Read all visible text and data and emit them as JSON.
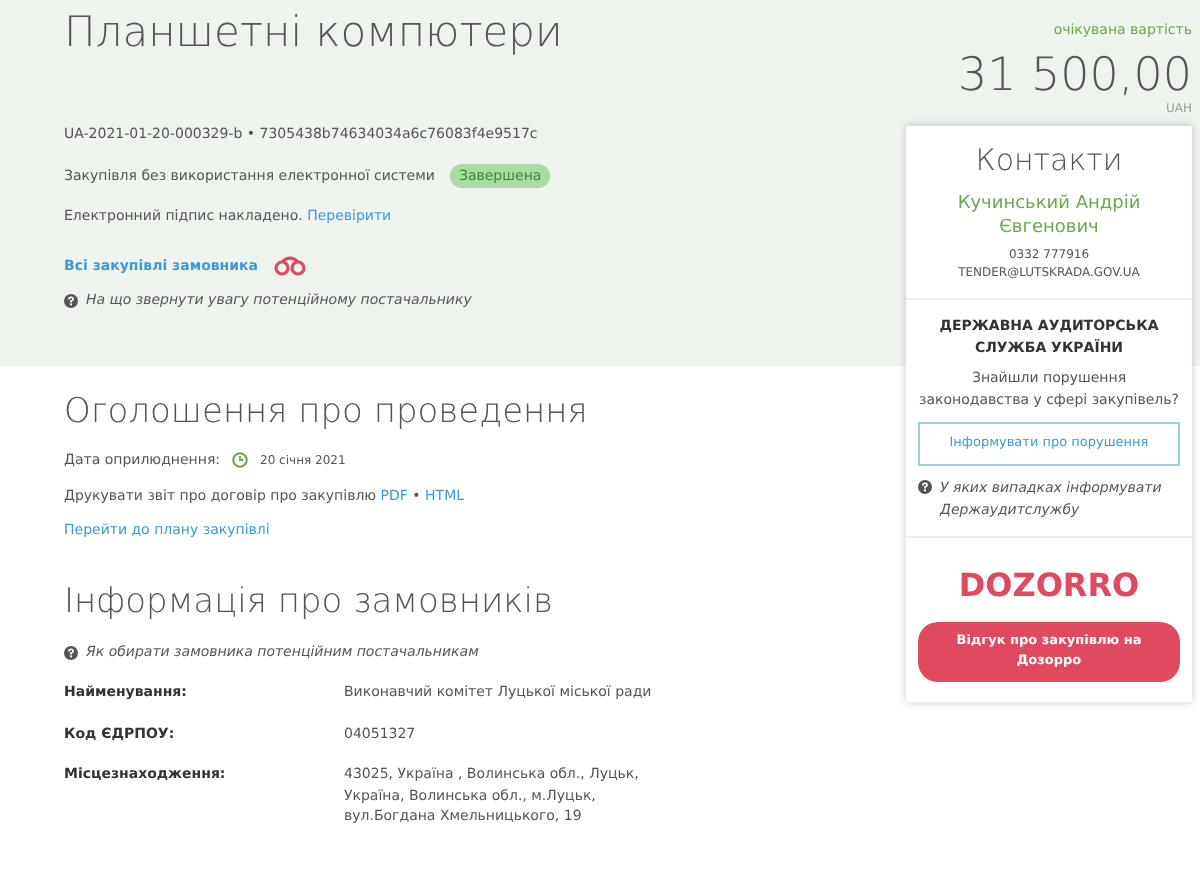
{
  "title": "Планшетні компютери",
  "price": {
    "label": "очікувана вартість",
    "amount": "31 500,00",
    "currency": "UAH"
  },
  "tender": {
    "id": "UA-2021-01-20-000329-b",
    "separator": "•",
    "hash": "7305438b74634034a6c76083f4e9517c",
    "procedure": "Закупівля без використання електронної системи",
    "status": "Завершена",
    "signature": "Електронний підпис накладено.",
    "signature_link": "Перевірити",
    "customer_link": "Всі закупівлі замовника",
    "hint": "На що звернути увагу потенційному постачальнику"
  },
  "announcement": {
    "heading": "Оголошення про проведення",
    "date_label": "Дата оприлюднення:",
    "date": "20 січня 2021",
    "print_label": "Друкувати звіт про договір про закупівлю",
    "print_links": [
      "PDF",
      "HTML"
    ],
    "separator": "•",
    "plan_link": "Перейти до плану закупівлі"
  },
  "customer": {
    "heading": "Інформація про замовників",
    "hint": "Як обирати замовника потенційним постачальникам",
    "rows": [
      {
        "label": "Найменування:",
        "value": "Виконавчий комітет Луцької міської ради"
      },
      {
        "label": "Код ЄДРПОУ:",
        "value": "04051327"
      },
      {
        "label": "Місцезнаходження:",
        "value": "43025, Україна , Волинська обл., Луцьк, Україна, Волинська обл., м.Луцьк, вул.Богдана Хмельницького, 19"
      }
    ]
  },
  "contacts": {
    "heading": "Контакти",
    "name": "Кучинський Андрій Євгенович",
    "phone": "0332 777916",
    "email": "TENDER@LUTSKRADA.GOV.UA"
  },
  "audit": {
    "heading": "ДЕРЖАВНА АУДИТОРСЬКА СЛУЖБА УКРАЇНИ",
    "question": "Знайшли порушення законодавства у сфері закупівель?",
    "button": "Інформувати про порушення",
    "hint": "У яких випадках інформувати Держаудитслужбу"
  },
  "dozorro": {
    "logo": "DOZORRO",
    "button": "Відгук про закупівлю на Дозорро"
  }
}
